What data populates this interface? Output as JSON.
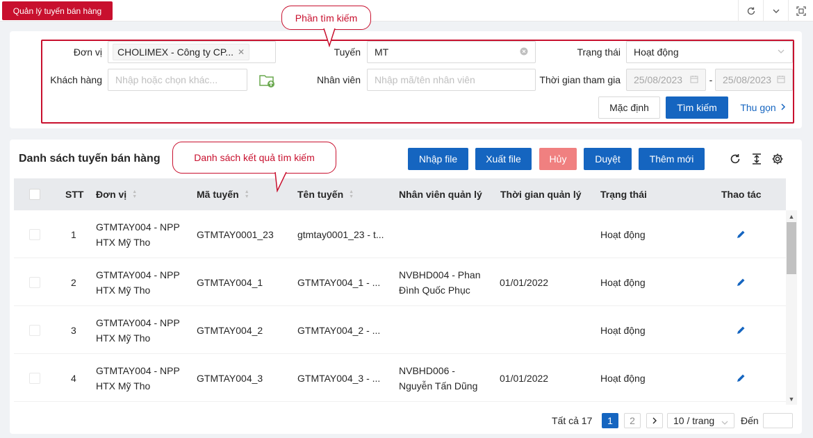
{
  "tabs": [
    {
      "label": "Quản lý tuyến bán hàng",
      "active": true
    }
  ],
  "topbar_icons": [
    "refresh-icon",
    "chevron-down-icon",
    "fullscreen-icon"
  ],
  "annotations": {
    "search_callout": "Phần tìm kiếm",
    "list_callout": "Danh sách kết quả tìm kiếm"
  },
  "search": {
    "don_vi": {
      "label": "Đơn vị",
      "tag": "CHOLIMEX - Công ty CP..."
    },
    "tuyen": {
      "label": "Tuyến",
      "value": "MT"
    },
    "trang_thai": {
      "label": "Trạng thái",
      "value": "Hoạt động"
    },
    "khach_hang": {
      "label": "Khách hàng",
      "placeholder": "Nhập hoặc chọn khác..."
    },
    "nhan_vien": {
      "label": "Nhân viên",
      "placeholder": "Nhập mã/tên nhân viên"
    },
    "thoi_gian": {
      "label": "Thời gian tham gia",
      "from": "25/08/2023",
      "separator": "-",
      "to": "25/08/2023"
    },
    "buttons": {
      "default": "Mặc định",
      "search": "Tìm kiếm",
      "collapse": "Thu gọn"
    }
  },
  "list": {
    "title": "Danh sách tuyến bán hàng",
    "actions": {
      "import": "Nhập file",
      "export": "Xuất file",
      "cancel": "Hủy",
      "approve": "Duyệt",
      "add": "Thêm mới"
    },
    "columns": [
      "STT",
      "Đơn vị",
      "Mã tuyến",
      "Tên tuyến",
      "Nhân viên quản lý",
      "Thời gian quản lý",
      "Trạng thái",
      "Thao tác"
    ],
    "rows": [
      {
        "stt": "1",
        "don_vi_1": "GTMTAY004 - NPP",
        "don_vi_2": "HTX Mỹ Tho",
        "ma_tuyen": "GTMTAY0001_23",
        "ten_tuyen": "gtmtay0001_23 - t...",
        "nv_1": "",
        "nv_2": "",
        "thoi_gian": "",
        "trang_thai": "Hoạt động"
      },
      {
        "stt": "2",
        "don_vi_1": "GTMTAY004 - NPP",
        "don_vi_2": "HTX Mỹ Tho",
        "ma_tuyen": "GTMTAY004_1",
        "ten_tuyen": "GTMTAY004_1 - ...",
        "nv_1": "NVBHD004 - Phan",
        "nv_2": "Đình Quốc Phục",
        "thoi_gian": "01/01/2022",
        "trang_thai": "Hoạt động"
      },
      {
        "stt": "3",
        "don_vi_1": "GTMTAY004 - NPP",
        "don_vi_2": "HTX Mỹ Tho",
        "ma_tuyen": "GTMTAY004_2",
        "ten_tuyen": "GTMTAY004_2 - ...",
        "nv_1": "",
        "nv_2": "",
        "thoi_gian": "",
        "trang_thai": "Hoạt động"
      },
      {
        "stt": "4",
        "don_vi_1": "GTMTAY004 - NPP",
        "don_vi_2": "HTX Mỹ Tho",
        "ma_tuyen": "GTMTAY004_3",
        "ten_tuyen": "GTMTAY004_3 - ...",
        "nv_1": "NVBHD006 -",
        "nv_2": "Nguyễn Tấn Dũng",
        "thoi_gian": "01/01/2022",
        "trang_thai": "Hoạt động"
      }
    ]
  },
  "pagination": {
    "total": "Tất cả 17",
    "pages": [
      "1",
      "2"
    ],
    "current": "1",
    "page_size": "10 / trang",
    "goto_label": "Đến"
  },
  "colors": {
    "brand_red": "#c8102e",
    "primary_blue": "#1565c0",
    "danger_light": "#f08080"
  }
}
